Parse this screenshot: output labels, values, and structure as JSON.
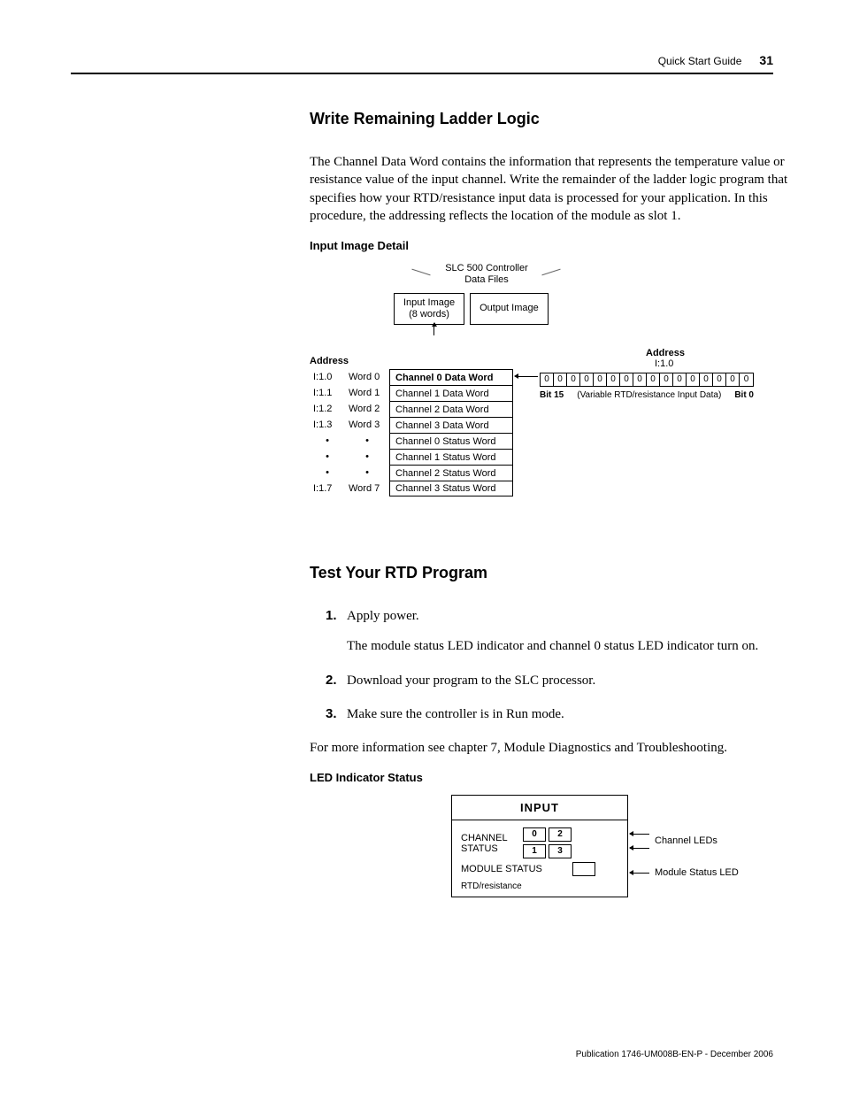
{
  "header": {
    "title": "Quick Start Guide",
    "page": "31"
  },
  "section1": {
    "heading": "Write Remaining Ladder Logic",
    "para": "The Channel Data Word contains the information that represents the temperature value or resistance value of the input channel. Write the remainder of the ladder logic program that specifies how your RTD/resistance input data is processed for your application. In this procedure, the addressing reflects the location of the module as slot 1."
  },
  "diagram1": {
    "subhead": "Input Image Detail",
    "slc_title": "SLC 500 Controller",
    "slc_sub": "Data Files",
    "input_box_l1": "Input Image",
    "input_box_l2": "(8 words)",
    "output_box": "Output Image",
    "address_label": "Address",
    "rows": [
      {
        "addr": "I:1.0",
        "word": "Word 0",
        "desc": "Channel 0 Data Word",
        "bold": true
      },
      {
        "addr": "I:1.1",
        "word": "Word 1",
        "desc": "Channel 1 Data Word",
        "bold": false
      },
      {
        "addr": "I:1.2",
        "word": "Word 2",
        "desc": "Channel 2 Data Word",
        "bold": false
      },
      {
        "addr": "I:1.3",
        "word": "Word 3",
        "desc": "Channel 3 Data Word",
        "bold": false
      },
      {
        "addr": "•",
        "word": "•",
        "desc": "Channel 0 Status Word",
        "bold": false
      },
      {
        "addr": "•",
        "word": "•",
        "desc": "Channel 1 Status Word",
        "bold": false
      },
      {
        "addr": "•",
        "word": "•",
        "desc": "Channel 2 Status Word",
        "bold": false
      },
      {
        "addr": "I:1.7",
        "word": "Word 7",
        "desc": "Channel 3 Status Word",
        "bold": false
      }
    ],
    "right": {
      "address_label": "Address",
      "address_value": "I:1.0",
      "bits": [
        "0",
        "0",
        "0",
        "0",
        "0",
        "0",
        "0",
        "0",
        "0",
        "0",
        "0",
        "0",
        "0",
        "0",
        "0",
        "0"
      ],
      "bit15": "Bit 15",
      "bit0": "Bit 0",
      "var_label": "(Variable RTD/resistance Input Data)"
    }
  },
  "section2": {
    "heading": "Test Your RTD Program",
    "steps": [
      {
        "text": "Apply power.",
        "sub": "The module status LED indicator and channel 0 status LED indicator turn on."
      },
      {
        "text": "Download your program to the SLC processor."
      },
      {
        "text": "Make sure the controller is in Run mode."
      }
    ],
    "follow": "For more information see chapter 7, Module Diagnostics and Troubleshooting."
  },
  "led": {
    "subhead": "LED Indicator Status",
    "panel_title": "INPUT",
    "channel_label": "CHANNEL\nSTATUS",
    "leds": [
      "0",
      "2",
      "1",
      "3"
    ],
    "module_label": "MODULE STATUS",
    "rtd_label": "RTD/resistance",
    "callout_channel": "Channel LEDs",
    "callout_module": "Module Status LED"
  },
  "footer": "Publication 1746-UM008B-EN-P - December 2006"
}
